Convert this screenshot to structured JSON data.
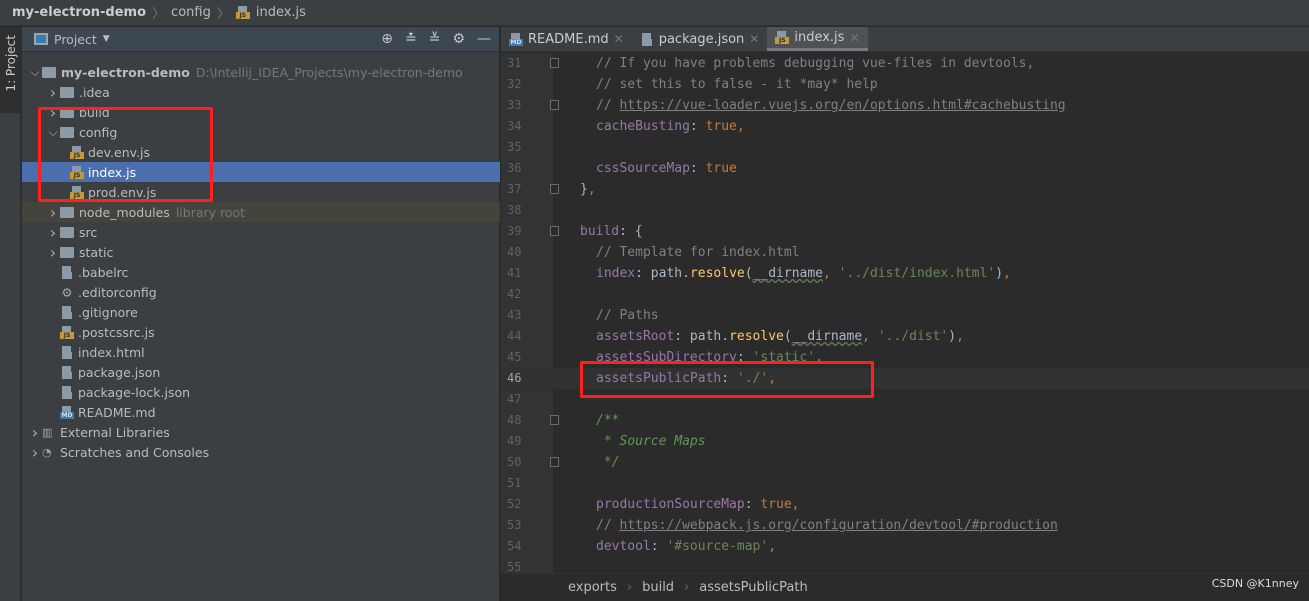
{
  "breadcrumb": [
    "my-electron-demo",
    "config",
    "index.js"
  ],
  "tool_strip": {
    "label": "1: Project"
  },
  "project_panel": {
    "title": "Project",
    "tools": [
      "locate-icon",
      "expand-all-icon",
      "collapse-all-icon",
      "gear-icon",
      "minimize-icon"
    ],
    "tree": [
      {
        "label": "my-electron-demo",
        "hint": "D:\\Intellij_IDEA_Projects\\my-electron-demo",
        "kind": "root",
        "depth": 0,
        "arrow": "open"
      },
      {
        "label": ".idea",
        "kind": "folder",
        "depth": 1,
        "arrow": "closed"
      },
      {
        "label": "build",
        "kind": "folder",
        "depth": 1,
        "arrow": "closed"
      },
      {
        "label": "config",
        "kind": "folder",
        "depth": 1,
        "arrow": "open"
      },
      {
        "label": "dev.env.js",
        "kind": "js",
        "depth": 2
      },
      {
        "label": "index.js",
        "kind": "js",
        "depth": 2,
        "selected": true
      },
      {
        "label": "prod.env.js",
        "kind": "js",
        "depth": 2
      },
      {
        "label": "node_modules",
        "hint": "library root",
        "kind": "folder",
        "depth": 1,
        "arrow": "closed",
        "library": true
      },
      {
        "label": "src",
        "kind": "folder",
        "depth": 1,
        "arrow": "closed"
      },
      {
        "label": "static",
        "kind": "folder",
        "depth": 1,
        "arrow": "closed"
      },
      {
        "label": ".babelrc",
        "kind": "file",
        "depth": 1
      },
      {
        "label": ".editorconfig",
        "kind": "config",
        "depth": 1
      },
      {
        "label": ".gitignore",
        "kind": "file",
        "depth": 1
      },
      {
        "label": ".postcssrc.js",
        "kind": "js",
        "depth": 1
      },
      {
        "label": "index.html",
        "kind": "html",
        "depth": 1
      },
      {
        "label": "package.json",
        "kind": "file",
        "depth": 1
      },
      {
        "label": "package-lock.json",
        "kind": "file",
        "depth": 1
      },
      {
        "label": "README.md",
        "kind": "md",
        "depth": 1
      },
      {
        "label": "External Libraries",
        "kind": "lib",
        "depth": 0,
        "arrow": "closed"
      },
      {
        "label": "Scratches and Consoles",
        "kind": "scratch",
        "depth": 0,
        "arrow": "closed"
      }
    ]
  },
  "editor_tabs": [
    {
      "label": "README.md",
      "icon": "md"
    },
    {
      "label": "package.json",
      "icon": "file"
    },
    {
      "label": "index.js",
      "icon": "js",
      "active": true
    }
  ],
  "code": {
    "current_line": 46,
    "lines": [
      {
        "n": 31,
        "i": 1,
        "fold": true,
        "t": [
          [
            "c",
            "// If you have problems debugging vue-files in devtools,"
          ]
        ]
      },
      {
        "n": 32,
        "i": 1,
        "t": [
          [
            "c",
            "// set this to false - it *may* help"
          ]
        ]
      },
      {
        "n": 33,
        "i": 1,
        "fold": true,
        "t": [
          [
            "c",
            "// "
          ],
          [
            "u",
            "https://vue-loader.vuejs.org/en/options.html#cachebusting"
          ]
        ]
      },
      {
        "n": 34,
        "i": 1,
        "t": [
          [
            "k",
            "cacheBusting"
          ],
          [
            "d",
            ": "
          ],
          [
            "b",
            "true,"
          ]
        ]
      },
      {
        "n": 35,
        "i": 0,
        "t": []
      },
      {
        "n": 36,
        "i": 1,
        "t": [
          [
            "k",
            "cssSourceMap"
          ],
          [
            "d",
            ": "
          ],
          [
            "b",
            "true"
          ]
        ]
      },
      {
        "n": 37,
        "i": 0,
        "fold": true,
        "t": [
          [
            "d",
            "}"
          ],
          [
            "b",
            ","
          ]
        ]
      },
      {
        "n": 38,
        "i": 0,
        "t": []
      },
      {
        "n": 39,
        "i": 0,
        "fold": true,
        "t": [
          [
            "k",
            "build"
          ],
          [
            "d",
            ": {"
          ]
        ]
      },
      {
        "n": 40,
        "i": 1,
        "t": [
          [
            "c",
            "// Template for index.html"
          ]
        ]
      },
      {
        "n": 41,
        "i": 1,
        "t": [
          [
            "k",
            "index"
          ],
          [
            "d",
            ": path."
          ],
          [
            "f",
            "resolve"
          ],
          [
            "d",
            "("
          ],
          [
            "w",
            "__dirname"
          ],
          [
            "b",
            ", "
          ],
          [
            "s",
            "'../dist/index.html'"
          ],
          [
            "d",
            ")"
          ],
          [
            "b",
            ","
          ]
        ]
      },
      {
        "n": 42,
        "i": 0,
        "t": []
      },
      {
        "n": 43,
        "i": 1,
        "t": [
          [
            "c",
            "// Paths"
          ]
        ]
      },
      {
        "n": 44,
        "i": 1,
        "t": [
          [
            "k",
            "assetsRoot"
          ],
          [
            "d",
            ": path."
          ],
          [
            "f",
            "resolve"
          ],
          [
            "d",
            "("
          ],
          [
            "w",
            "__dirname"
          ],
          [
            "b",
            ", "
          ],
          [
            "s",
            "'../dist'"
          ],
          [
            "d",
            ")"
          ],
          [
            "b",
            ","
          ]
        ]
      },
      {
        "n": 45,
        "i": 1,
        "t": [
          [
            "k",
            "assetsSubDirectory"
          ],
          [
            "d",
            ": "
          ],
          [
            "s",
            "'static'"
          ],
          [
            "b",
            ","
          ]
        ]
      },
      {
        "n": 46,
        "i": 1,
        "t": [
          [
            "k",
            "assetsPublicPath"
          ],
          [
            "d",
            ": "
          ],
          [
            "s",
            "'./'"
          ],
          [
            "b",
            ","
          ]
        ]
      },
      {
        "n": 47,
        "i": 0,
        "t": []
      },
      {
        "n": 48,
        "i": 1,
        "fold": true,
        "t": [
          [
            "doc",
            "/**"
          ]
        ]
      },
      {
        "n": 49,
        "i": 1,
        "t": [
          [
            "doc",
            " * Source Maps"
          ]
        ]
      },
      {
        "n": 50,
        "i": 1,
        "fold": true,
        "t": [
          [
            "doc",
            " */"
          ]
        ]
      },
      {
        "n": 51,
        "i": 0,
        "t": []
      },
      {
        "n": 52,
        "i": 1,
        "t": [
          [
            "k",
            "productionSourceMap"
          ],
          [
            "d",
            ": "
          ],
          [
            "b",
            "true,"
          ]
        ]
      },
      {
        "n": 53,
        "i": 1,
        "t": [
          [
            "c",
            "// "
          ],
          [
            "u",
            "https://webpack.js.org/configuration/devtool/#production"
          ]
        ]
      },
      {
        "n": 54,
        "i": 1,
        "t": [
          [
            "k",
            "devtool"
          ],
          [
            "d",
            ": "
          ],
          [
            "s",
            "'#source-map'"
          ],
          [
            "b",
            ","
          ]
        ]
      },
      {
        "n": 55,
        "i": 0,
        "t": []
      }
    ]
  },
  "code_breadcrumb": [
    "exports",
    "build",
    "assetsPublicPath"
  ],
  "watermark": "CSDN @K1nney",
  "colors": {
    "highlight_box": "#ff2020",
    "selection": "#4b6eaf",
    "keyword": "#cc7832",
    "property": "#9876aa",
    "string": "#6a8759"
  }
}
